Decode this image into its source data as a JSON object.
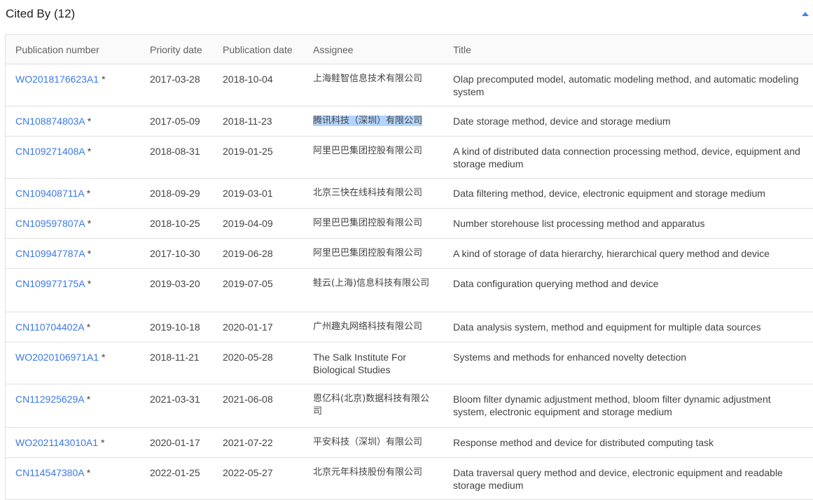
{
  "section": {
    "title": "Cited By (12)"
  },
  "table": {
    "headers": [
      "Publication number",
      "Priority date",
      "Publication date",
      "Assignee",
      "Title"
    ],
    "rows": [
      {
        "pub": "WO2018176623A1",
        "star": "*",
        "priority": "2017-03-28",
        "published": "2018-10-04",
        "assignee": "上海鲑智信息技术有限公司",
        "title": "Olap precomputed model, automatic modeling method, and automatic modeling system"
      },
      {
        "pub": "CN108874803A",
        "star": "*",
        "priority": "2017-05-09",
        "published": "2018-11-23",
        "assignee": "腾讯科技（深圳）有限公司",
        "title": "Date storage method, device and storage medium"
      },
      {
        "pub": "CN109271408A",
        "star": "*",
        "priority": "2018-08-31",
        "published": "2019-01-25",
        "assignee": "阿里巴巴集团控股有限公司",
        "title": "A kind of distributed data connection processing method, device, equipment and storage medium"
      },
      {
        "pub": "CN109408711A",
        "star": "*",
        "priority": "2018-09-29",
        "published": "2019-03-01",
        "assignee": "北京三快在线科技有限公司",
        "title": "Data filtering method, device, electronic equipment and storage medium"
      },
      {
        "pub": "CN109597807A",
        "star": "*",
        "priority": "2018-10-25",
        "published": "2019-04-09",
        "assignee": "阿里巴巴集团控股有限公司",
        "title": "Number storehouse list processing method and apparatus"
      },
      {
        "pub": "CN109947787A",
        "star": "*",
        "priority": "2017-10-30",
        "published": "2019-06-28",
        "assignee": "阿里巴巴集团控股有限公司",
        "title": "A kind of storage of data hierarchy, hierarchical query method and device"
      },
      {
        "pub": "CN109977175A",
        "star": "*",
        "priority": "2019-03-20",
        "published": "2019-07-05",
        "assignee": "鲑云(上海)信息科技有限公司",
        "title": "Data configuration querying method and device"
      },
      {
        "pub": "CN110704402A",
        "star": "*",
        "priority": "2019-10-18",
        "published": "2020-01-17",
        "assignee": "广州趣丸网络科技有限公司",
        "title": "Data analysis system, method and equipment for multiple data sources"
      },
      {
        "pub": "WO2020106971A1",
        "star": "*",
        "priority": "2018-11-21",
        "published": "2020-05-28",
        "assignee": "The Salk Institute For Biological Studies",
        "title": "Systems and methods for enhanced novelty detection"
      },
      {
        "pub": "CN112925629A",
        "star": "*",
        "priority": "2021-03-31",
        "published": "2021-06-08",
        "assignee": "恩亿科(北京)数据科技有限公司",
        "title": "Bloom filter dynamic adjustment method, bloom filter dynamic adjustment system, electronic equipment and storage medium"
      },
      {
        "pub": "WO2021143010A1",
        "star": "*",
        "priority": "2020-01-17",
        "published": "2021-07-22",
        "assignee": "平安科技（深圳）有限公司",
        "title": "Response method and device for distributed computing task"
      },
      {
        "pub": "CN114547380A",
        "star": "*",
        "priority": "2022-01-25",
        "published": "2022-05-27",
        "assignee": "北京元年科技股份有限公司",
        "title": "Data traversal query method and device, electronic equipment and readable storage medium"
      }
    ]
  },
  "icons": {
    "collapse": "chevron-up-icon"
  },
  "colors": {
    "link": "#3b78e7",
    "collapse_icon": "#4285f4",
    "selection": "#b3d4fc"
  }
}
